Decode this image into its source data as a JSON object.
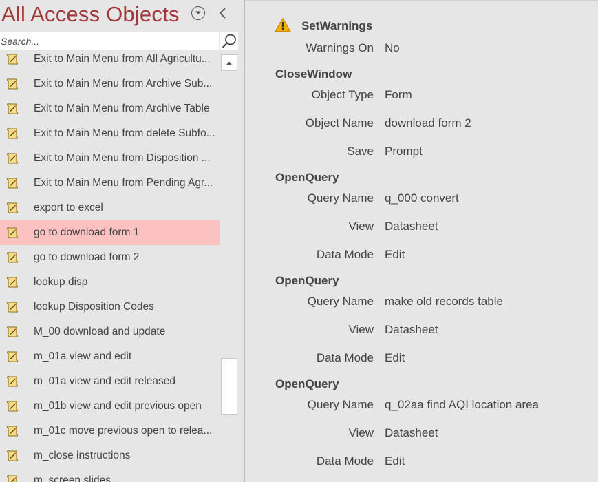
{
  "nav": {
    "title": "All Access Objects",
    "search_placeholder": "Search...",
    "items": [
      {
        "label": "Exit to Main Menu from All Agricultu..."
      },
      {
        "label": "Exit to Main Menu from Archive Sub..."
      },
      {
        "label": "Exit to Main Menu from Archive Table"
      },
      {
        "label": "Exit to Main Menu from delete Subfo..."
      },
      {
        "label": "Exit to Main Menu from Disposition ..."
      },
      {
        "label": "Exit to Main Menu from Pending Agr..."
      },
      {
        "label": "export to excel"
      },
      {
        "label": "go to download form 1",
        "selected": true
      },
      {
        "label": "go to download form 2"
      },
      {
        "label": "lookup disp"
      },
      {
        "label": "lookup Disposition Codes"
      },
      {
        "label": "M_00 download and update"
      },
      {
        "label": "m_01a view and edit"
      },
      {
        "label": "m_01a view and edit released"
      },
      {
        "label": "m_01b view and edit previous open"
      },
      {
        "label": "m_01c move previous open to relea..."
      },
      {
        "label": "m_close instructions"
      },
      {
        "label": "m_screen slides"
      }
    ]
  },
  "macro": {
    "actions": [
      {
        "name": "SetWarnings",
        "warning": true,
        "args": [
          {
            "label": "Warnings On",
            "value": "No"
          }
        ]
      },
      {
        "name": "CloseWindow",
        "args": [
          {
            "label": "Object Type",
            "value": "Form"
          },
          {
            "label": "Object Name",
            "value": "download form 2"
          },
          {
            "label": "Save",
            "value": "Prompt"
          }
        ]
      },
      {
        "name": "OpenQuery",
        "args": [
          {
            "label": "Query Name",
            "value": "q_000 convert"
          },
          {
            "label": "View",
            "value": "Datasheet"
          },
          {
            "label": "Data Mode",
            "value": "Edit"
          }
        ]
      },
      {
        "name": "OpenQuery",
        "args": [
          {
            "label": "Query Name",
            "value": "make old records table"
          },
          {
            "label": "View",
            "value": "Datasheet"
          },
          {
            "label": "Data Mode",
            "value": "Edit"
          }
        ]
      },
      {
        "name": "OpenQuery",
        "args": [
          {
            "label": "Query Name",
            "value": "q_02aa find AQI location area"
          },
          {
            "label": "View",
            "value": "Datasheet"
          },
          {
            "label": "Data Mode",
            "value": "Edit"
          }
        ]
      }
    ]
  },
  "colors": {
    "title": "#a4373a",
    "selected_row": "#fcc2c2",
    "background": "#e6e6e6",
    "warning": "#e8a317"
  },
  "icons": {
    "item": "macro-scroll-icon",
    "menu": "chevron-down-circle-icon",
    "collapse": "chevron-left-icon",
    "search": "search-icon",
    "warning": "warning-triangle-icon"
  }
}
